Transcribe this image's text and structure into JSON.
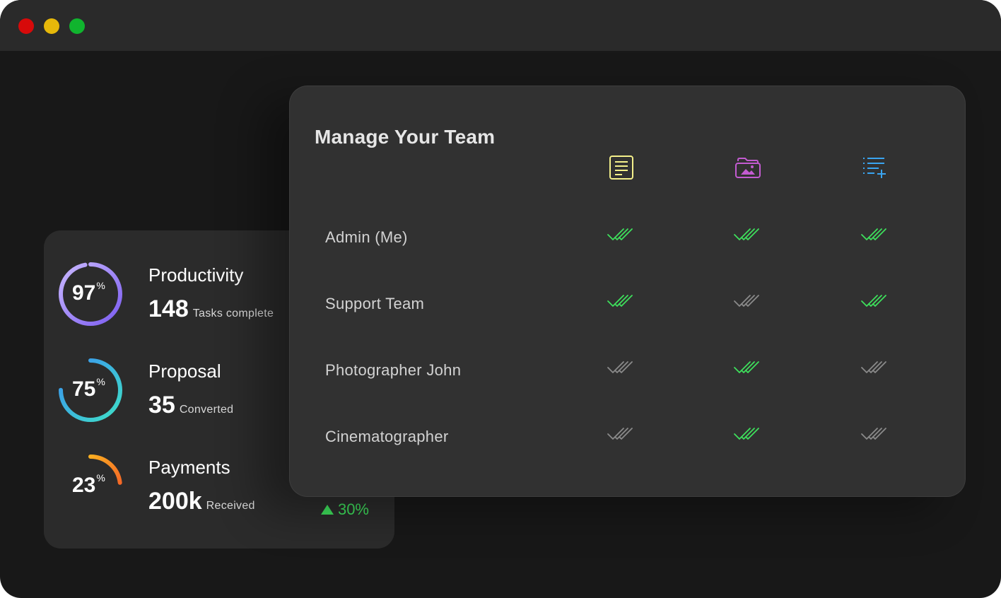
{
  "window": {
    "controls": [
      "close",
      "minimize",
      "maximize"
    ]
  },
  "stats": [
    {
      "percent": "97",
      "percent_sign": "%",
      "title": "Productivity",
      "value": "148",
      "caption": "Tasks complete",
      "ring_fraction": 0.97,
      "gradient": [
        "#7b5cf0",
        "#c9b8ff"
      ]
    },
    {
      "percent": "75",
      "percent_sign": "%",
      "title": "Proposal",
      "value": "35",
      "caption": "Converted",
      "ring_fraction": 0.75,
      "gradient": [
        "#3fe0c8",
        "#3a8ff0"
      ]
    },
    {
      "percent": "23",
      "percent_sign": "%",
      "title": "Payments",
      "value": "200k",
      "caption": "Received",
      "ring_fraction": 0.23,
      "gradient": [
        "#f0402a",
        "#ffd21e"
      ],
      "trend": "30%"
    }
  ],
  "team": {
    "title": "Manage Your Team",
    "columns": [
      {
        "icon": "document-icon",
        "color": "#f4f08a"
      },
      {
        "icon": "image-folder-icon",
        "color": "#c35bd1"
      },
      {
        "icon": "add-list-icon",
        "color": "#3aa4f0"
      }
    ],
    "rows": [
      {
        "label": "Admin (Me)",
        "permissions": [
          true,
          true,
          true
        ]
      },
      {
        "label": "Support Team",
        "permissions": [
          true,
          false,
          true
        ]
      },
      {
        "label": "Photographer John",
        "permissions": [
          false,
          true,
          false
        ]
      },
      {
        "label": "Cinematographer",
        "permissions": [
          false,
          true,
          false
        ]
      }
    ],
    "colors": {
      "on": "#3ee05c",
      "off": "#8a8a8a"
    }
  }
}
